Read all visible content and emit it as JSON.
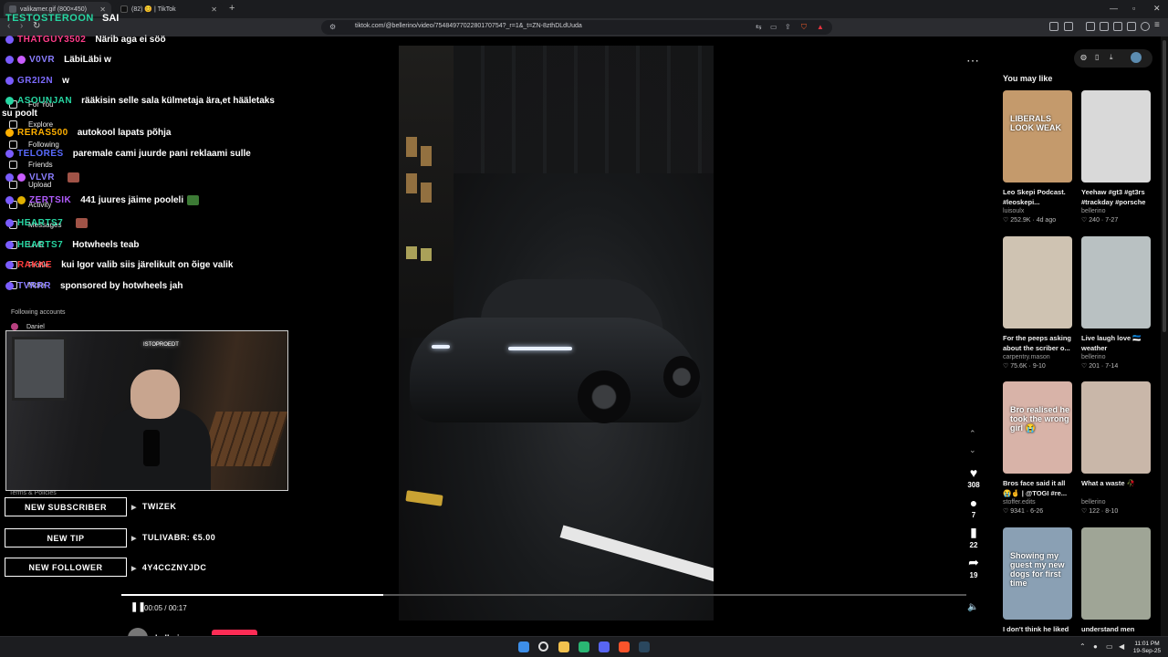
{
  "browser": {
    "tabs": [
      {
        "label": "valikamer.gif (800×450)"
      },
      {
        "label": "(82) 😊 | TikTok"
      }
    ],
    "url": "tiktok.com/@bellerino/video/7548497702280170754?_r=1&_t=ZN-8zthDLdUuda"
  },
  "header": {
    "name": "TESTOSTEROON",
    "tag": "SAI"
  },
  "chat": [
    {
      "user": "THATGUY3502",
      "color": "#ff3d8a",
      "msg": "Närib aga ei söö"
    },
    {
      "user": "V0VR",
      "color": "#8a7dff",
      "msg": "LäbiLäbi w"
    },
    {
      "user": "GR2I2N",
      "color": "#7d6bff",
      "msg": "w"
    },
    {
      "user": "ASOUNJAN",
      "color": "#27d6a2",
      "msg": "rääkisin selle sala külmetaja ära,et hääletaks"
    },
    {
      "user": "su poolt",
      "color": "#ffffff",
      "msg": ""
    },
    {
      "user": "RERAS500",
      "color": "#ffb000",
      "msg": "autokool lapats põhja"
    },
    {
      "user": "TELORES",
      "color": "#5a6bff",
      "msg": "paremale cami juurde pani reklaami sulle"
    },
    {
      "user": "VLVR",
      "color": "#8a7dff",
      "msg": ""
    },
    {
      "user": "ZERTSIK",
      "color": "#b25cff",
      "msg": "441 juures jäime pooleli"
    },
    {
      "user": "HEARTS7",
      "color": "#27d6a2",
      "msg": ""
    },
    {
      "user": "HEARTS7",
      "color": "#27d6a2",
      "msg": "Hotwheels teab"
    },
    {
      "user": "RAKKE",
      "color": "#ff3d3d",
      "msg": "kui Igor valib siis järelikult on õige valik"
    },
    {
      "user": "TVRRR",
      "color": "#8a7dff",
      "msg": "sponsored by hotwheels jah"
    }
  ],
  "tiktok_nav": [
    {
      "label": "For You"
    },
    {
      "label": "Explore"
    },
    {
      "label": "Following"
    },
    {
      "label": "Friends"
    },
    {
      "label": "Upload"
    },
    {
      "label": "Activity"
    },
    {
      "label": "Messages"
    },
    {
      "label": "LIVE"
    },
    {
      "label": "Profile"
    },
    {
      "label": "More"
    }
  ],
  "following_accounts": {
    "heading": "Following accounts",
    "user": "Daniel"
  },
  "terms": "Terms & Policies",
  "webcam": {
    "neon": "ISTOPROEDT"
  },
  "alerts": [
    {
      "label": "NEW SUBSCRIBER",
      "value": "TWIZEK"
    },
    {
      "label": "NEW TIP",
      "value": "TULIVABR: €5.00"
    },
    {
      "label": "NEW FOLLOWER",
      "value": "4Y4CCZNYJDC"
    }
  ],
  "video": {
    "likes": "308",
    "comments": "7",
    "saves": "22",
    "shares": "19",
    "time": "00:05 / 00:17",
    "progress": 0.31,
    "author": "bellerino"
  },
  "you_may_like": {
    "title": "You may like",
    "cards": [
      {
        "caption": "Leo Skepi Podcast. #leoskepi...",
        "author": "luisoulx",
        "likes": "252.9K",
        "date": "4d ago",
        "thumb_text": "LIBERALS LOOK WEAK",
        "bg": "#c49a6c"
      },
      {
        "caption": "Yeehaw #gt3 #gt3rs #trackday #porsche",
        "author": "bellerino",
        "likes": "240",
        "date": "7-27",
        "thumb_text": "",
        "bg": "#d9d9d9"
      },
      {
        "caption": "For the peeps asking about the scriber o...",
        "author": "carpentry.mason",
        "likes": "75.6K",
        "date": "9-10",
        "thumb_text": "",
        "bg": "#cfc3b2"
      },
      {
        "caption": "Live laugh love 🇪🇪 weather",
        "author": "bellerino",
        "likes": "201",
        "date": "7-14",
        "thumb_text": "",
        "bg": "#b9c1c2"
      },
      {
        "caption": "Bros face said it all 😭🤞 | @TOGI #re...",
        "author": "stoffer.edits",
        "likes": "9341",
        "date": "6-26",
        "thumb_text": "Bro realised he took the wrong girl 😭",
        "bg": "#d8b3a8"
      },
      {
        "caption": "What a waste 🥀",
        "author": "bellerino",
        "likes": "122",
        "date": "8-10",
        "thumb_text": "",
        "bg": "#c9b7a9"
      },
      {
        "caption": "I don't think he liked",
        "author": "",
        "likes": "",
        "date": "",
        "thumb_text": "Showing my guest my new dogs for first time",
        "bg": "#8aa0b4"
      },
      {
        "caption": "understand men",
        "author": "",
        "likes": "",
        "date": "",
        "thumb_text": "",
        "bg": "#9fa596"
      }
    ]
  },
  "taskbar": {
    "time": "11:01 PM",
    "date": "19-Sep-25"
  }
}
